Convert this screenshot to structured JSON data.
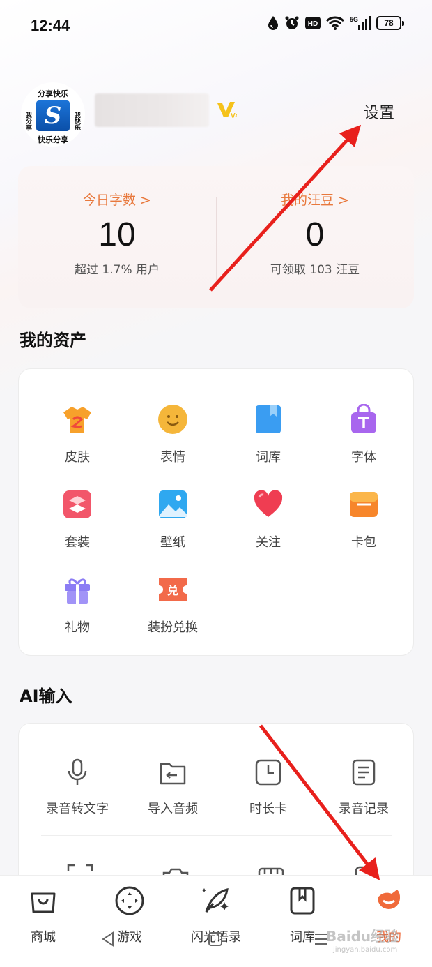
{
  "status_bar": {
    "time": "12:44",
    "battery": "78",
    "icons": [
      "water-drop-icon",
      "alarm-icon",
      "hd-icon",
      "wifi-icon",
      "5g-signal-icon"
    ],
    "hd_text": "HD",
    "signal_text": "5G"
  },
  "profile": {
    "avatar_texts": [
      "分享快乐",
      "我分享",
      "我快乐",
      "快乐分享"
    ],
    "avatar_logo": "S",
    "vip_level": "V4",
    "settings_label": "设置"
  },
  "stats": {
    "words_label": "今日字数 >",
    "words_value": "10",
    "words_sub": "超过 1.7% 用户",
    "beans_label": "我的汪豆 >",
    "beans_value": "0",
    "beans_sub": "可领取 103 汪豆"
  },
  "assets": {
    "title": "我的资产",
    "items": [
      {
        "label": "皮肤",
        "icon": "shirt-icon",
        "color": "#f7a12b"
      },
      {
        "label": "表情",
        "icon": "smiley-icon",
        "color": "#f5b63a"
      },
      {
        "label": "词库",
        "icon": "book-icon",
        "color": "#3a9df2"
      },
      {
        "label": "字体",
        "icon": "shopping-bag-t-icon",
        "color": "#a866ee"
      },
      {
        "label": "套装",
        "icon": "suit-icon",
        "color": "#f2566a"
      },
      {
        "label": "壁纸",
        "icon": "wallpaper-icon",
        "color": "#2fa8f0"
      },
      {
        "label": "关注",
        "icon": "heart-icon",
        "color": "#ef3d52"
      },
      {
        "label": "卡包",
        "icon": "card-wallet-icon",
        "color": "#f7862b"
      },
      {
        "label": "礼物",
        "icon": "gift-icon",
        "color": "#8b7cf4"
      },
      {
        "label": "装扮兑换",
        "icon": "exchange-ticket-icon",
        "color": "#f26a4a",
        "glyph": "兑"
      }
    ]
  },
  "ai_input": {
    "title": "AI输入",
    "items": [
      {
        "label": "录音转文字",
        "icon": "microphone-icon"
      },
      {
        "label": "导入音频",
        "icon": "folder-import-icon"
      },
      {
        "label": "时长卡",
        "icon": "clock-card-icon"
      },
      {
        "label": "录音记录",
        "icon": "document-list-icon"
      }
    ]
  },
  "bottom_nav": {
    "items": [
      {
        "label": "商城",
        "icon": "shopping-bag-icon"
      },
      {
        "label": "游戏",
        "icon": "gamepad-icon"
      },
      {
        "label": "闪光语录",
        "icon": "feather-icon"
      },
      {
        "label": "词库",
        "icon": "book-bookmark-icon"
      },
      {
        "label": "我的",
        "icon": "profile-face-icon"
      }
    ],
    "active_color": "#f06a3a"
  },
  "watermark": {
    "text": "Baidu经验",
    "sub": "jingyan.baidu.com"
  },
  "colors": {
    "accent": "#e8783c",
    "arrow": "#e8201c"
  }
}
